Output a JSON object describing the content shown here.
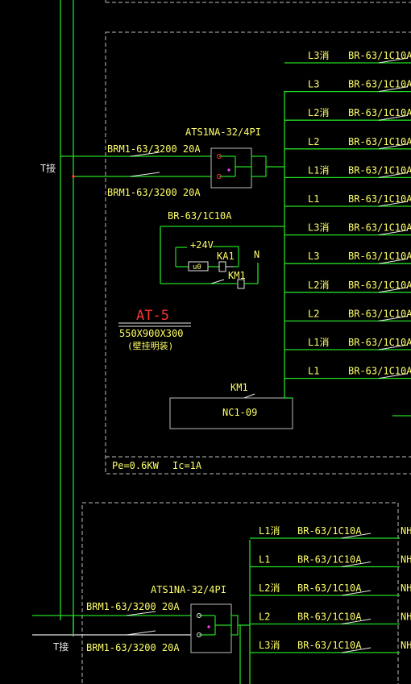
{
  "upper": {
    "supply_label": "T接",
    "ats_label": "ATS1NA-32/4PI",
    "incoming_breaker_1": "BRM1-63/3200 20A",
    "incoming_breaker_2": "BRM1-63/3200 20A",
    "control_breaker": "BR-63/1C10A",
    "v24": "+24V",
    "u0": "u0",
    "ka1": "KA1",
    "n": "N",
    "km1_small": "KM1",
    "panel_name": "AT-5",
    "panel_dims": "550X900X300",
    "panel_mount": "(壁挂明装)",
    "contactor_label": "KM1",
    "contactor_model": "NC1-09",
    "pe": "Pe=0.6KW",
    "ic": "Ic=1A",
    "circuits": [
      {
        "phase": "L3消",
        "breaker": "BR-63/1C10A"
      },
      {
        "phase": "L3",
        "breaker": "BR-63/1C10A"
      },
      {
        "phase": "L2消",
        "breaker": "BR-63/1C10A"
      },
      {
        "phase": "L2",
        "breaker": "BR-63/1C10A"
      },
      {
        "phase": "L1消",
        "breaker": "BR-63/1C10A"
      },
      {
        "phase": "L1",
        "breaker": "BR-63/1C10A"
      },
      {
        "phase": "L3消",
        "breaker": "BR-63/1C10A"
      },
      {
        "phase": "L3",
        "breaker": "BR-63/1C10A"
      },
      {
        "phase": "L2消",
        "breaker": "BR-63/1C10A"
      },
      {
        "phase": "L2",
        "breaker": "BR-63/1C10A"
      },
      {
        "phase": "L1消",
        "breaker": "BR-63/1C10A"
      },
      {
        "phase": "L1",
        "breaker": "BR-63/1C10A"
      }
    ]
  },
  "lower": {
    "supply_label": "T接",
    "ats_label": "ATS1NA-32/4PI",
    "incoming_breaker_1": "BRM1-63/3200 20A",
    "incoming_breaker_2": "BRM1-63/3200 20A",
    "circuits": [
      {
        "phase": "L1消",
        "breaker": "BR-63/1C10A",
        "cable": "NH"
      },
      {
        "phase": "L1",
        "breaker": "BR-63/1C10A",
        "cable": "NH"
      },
      {
        "phase": "L2消",
        "breaker": "BR-63/1C10A",
        "cable": "NH"
      },
      {
        "phase": "L2",
        "breaker": "BR-63/1C10A",
        "cable": "NH"
      },
      {
        "phase": "L3消",
        "breaker": "BR-63/1C10A",
        "cable": "NH"
      }
    ]
  },
  "colors": {
    "background": "#000000",
    "wire": "#22dd22",
    "text": "#ffff66",
    "title": "#ff3333",
    "frame": "#bbbbbb"
  }
}
